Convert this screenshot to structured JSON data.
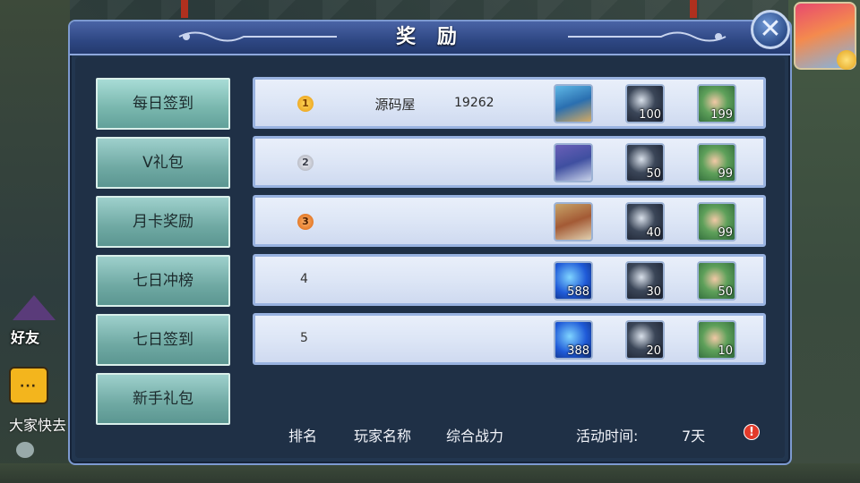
{
  "title": "奖 励",
  "tabs": [
    {
      "label": "每日签到"
    },
    {
      "label": "V礼包"
    },
    {
      "label": "月卡奖励"
    },
    {
      "label": "七日冲榜"
    },
    {
      "label": "七日签到"
    },
    {
      "label": "新手礼包"
    }
  ],
  "rows": [
    {
      "rank": "1",
      "player": "源码屋",
      "power": "19262",
      "rewards": [
        "",
        "100",
        "199"
      ]
    },
    {
      "rank": "2",
      "player": "",
      "power": "",
      "rewards": [
        "",
        "50",
        "99"
      ]
    },
    {
      "rank": "3",
      "player": "",
      "power": "",
      "rewards": [
        "",
        "40",
        "99"
      ]
    },
    {
      "rank": "4",
      "player": "",
      "power": "",
      "rewards": [
        "588",
        "30",
        "50"
      ]
    },
    {
      "rank": "5",
      "player": "",
      "power": "",
      "rewards": [
        "388",
        "20",
        "10"
      ]
    }
  ],
  "footer": {
    "rank_header": "排名",
    "player_header": "玩家名称",
    "power_header": "综合战力",
    "time_label": "活动时间:",
    "time_value": "7天",
    "warn_symbol": "!"
  },
  "background": {
    "friends_label": "好友",
    "chat_preview": "大家快去",
    "chat_icon": "···"
  },
  "close_symbol": "✕"
}
